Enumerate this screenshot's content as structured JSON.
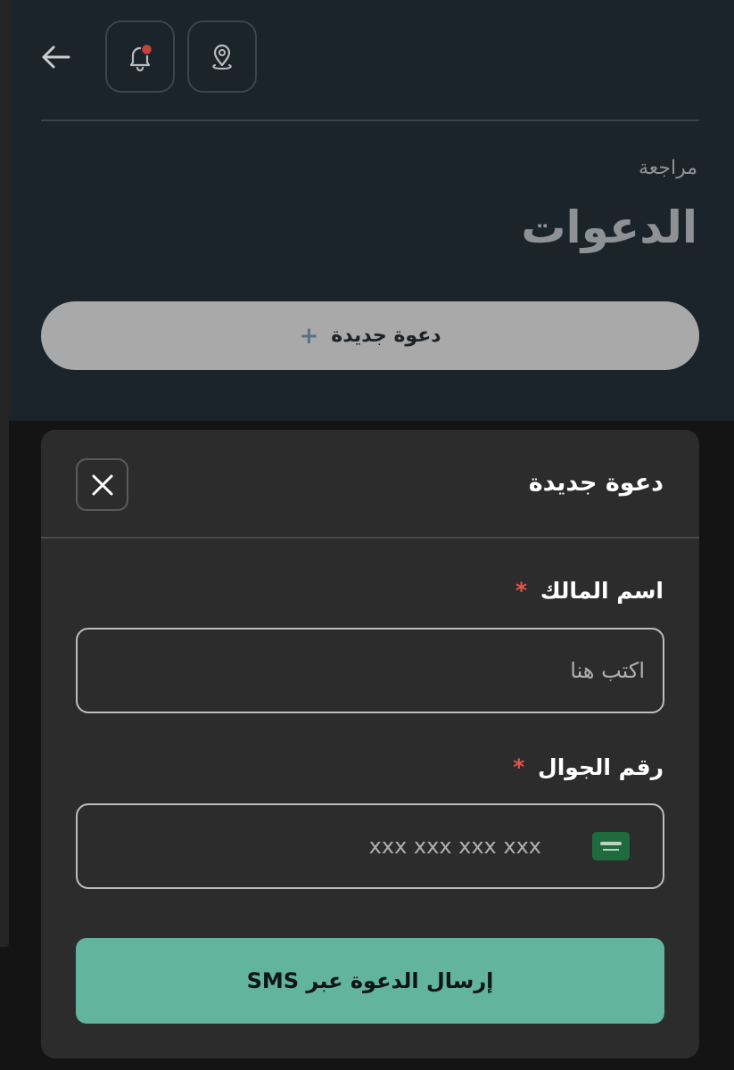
{
  "header": {
    "back_icon": "arrow-left-icon",
    "notification_icon": "bell-icon",
    "notification_badge_color": "#e0584a",
    "location_icon": "location-pin-icon"
  },
  "section": {
    "subtitle": "مراجعة",
    "title": "الدعوات",
    "new_invite_label": "دعوة جديدة",
    "new_invite_icon": "+"
  },
  "modal": {
    "title": "دعوة جديدة",
    "close_icon": "close-icon",
    "owner_field": {
      "label": "اسم المالك",
      "required_mark": "*",
      "placeholder": "اكتب هنا",
      "value": ""
    },
    "phone_field": {
      "label": "رقم الجوال",
      "required_mark": "*",
      "placeholder": "xxx xxx xxx xxx",
      "value": "",
      "country_flag_icon": "saudi-flag-icon"
    },
    "submit_label": "إرسال الدعوة عبر SMS"
  },
  "colors": {
    "accent": "#62b49c",
    "required": "#e0584a",
    "modal_bg": "#2c2c2c",
    "page_bg": "#1b232b"
  }
}
